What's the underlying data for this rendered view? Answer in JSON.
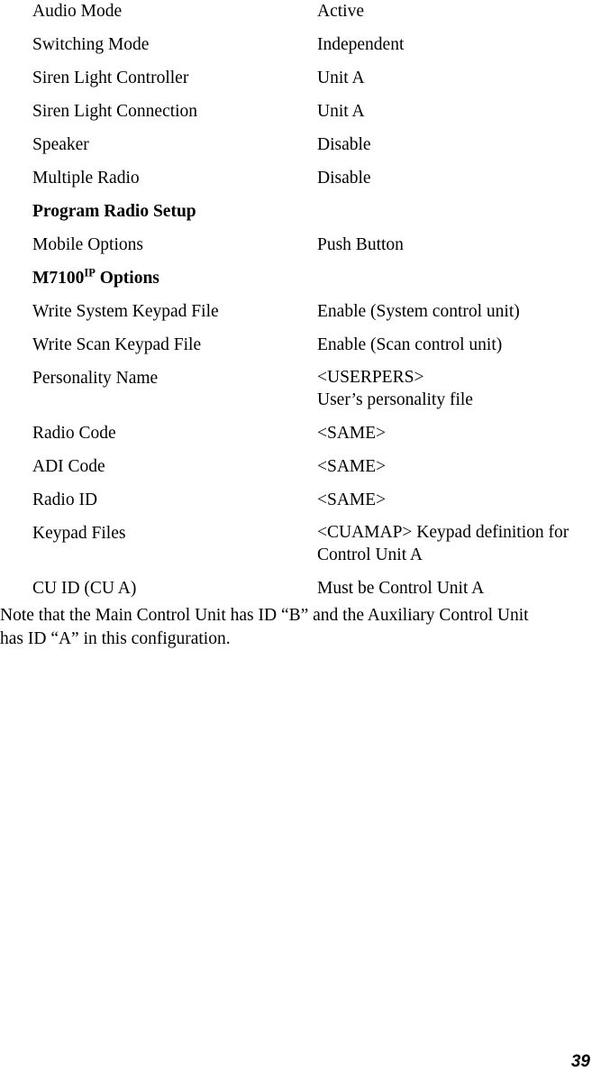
{
  "document": {
    "page_number": "39",
    "rows": [
      {
        "label": "Audio Mode",
        "value": "Active"
      },
      {
        "label": "Switching Mode",
        "value": "Independent"
      },
      {
        "label": "Siren Light Controller",
        "value": "Unit A"
      },
      {
        "label": "Siren Light Connection",
        "value": "Unit A"
      },
      {
        "label": "Speaker",
        "value": "Disable"
      },
      {
        "label": "Multiple Radio",
        "value": "Disable"
      }
    ],
    "heading_program_radio_setup": "Program Radio Setup",
    "rows_program": [
      {
        "label": "Mobile Options",
        "value": "Push Button"
      }
    ],
    "heading_m7100": {
      "base": "M7100",
      "superscript": "IP",
      "suffix": " Options"
    },
    "rows_m7100": [
      {
        "label": "Write System Keypad File",
        "value": "Enable (System control unit)"
      },
      {
        "label": "Write Scan Keypad File",
        "value": "Enable (Scan control unit)"
      }
    ],
    "row_personality": {
      "label": "Personality Name",
      "value_line1": "<USERPERS>",
      "value_line2": "User’s personality file"
    },
    "rows_codes": [
      {
        "label": "Radio Code",
        "value": "<SAME>"
      },
      {
        "label": "ADI Code",
        "value": "<SAME>"
      },
      {
        "label": "Radio ID",
        "value": "<SAME>"
      }
    ],
    "row_keypad_files": {
      "label": "Keypad Files",
      "value": "<CUAMAP> Keypad definition for Control Unit A"
    },
    "rows_cuid": [
      {
        "label": "CU ID (CU A)",
        "value": "Must be Control Unit A"
      }
    ],
    "note": {
      "line1": "Note that the Main Control Unit has ID “B” and the Auxiliary Control Unit",
      "line2": "has ID “A” in this configuration."
    }
  }
}
